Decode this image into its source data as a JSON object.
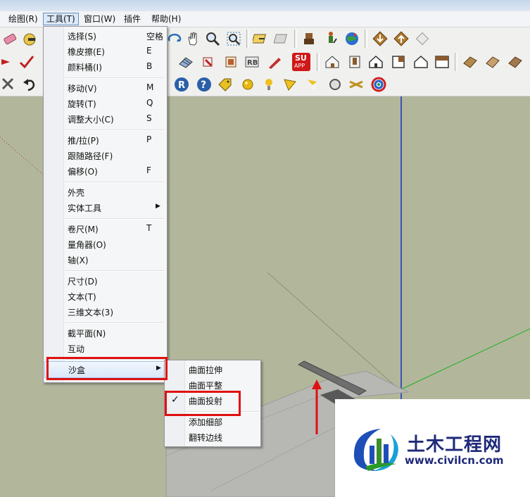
{
  "menubar": {
    "items": [
      {
        "label": "绘图(R)"
      },
      {
        "label": "工具(T)"
      },
      {
        "label": "窗口(W)"
      },
      {
        "label": "插件"
      },
      {
        "label": "帮助(H)"
      }
    ]
  },
  "tools_menu": {
    "items": [
      {
        "label": "选择(S)",
        "shortcut": "空格"
      },
      {
        "label": "橡皮擦(E)",
        "shortcut": "E"
      },
      {
        "label": "颜料桶(I)",
        "shortcut": "B"
      },
      {
        "label": "移动(V)",
        "shortcut": "M"
      },
      {
        "label": "旋转(T)",
        "shortcut": "Q"
      },
      {
        "label": "调整大小(C)",
        "shortcut": "S"
      },
      {
        "label": "推/拉(P)",
        "shortcut": "P"
      },
      {
        "label": "跟随路径(F)",
        "shortcut": ""
      },
      {
        "label": "偏移(O)",
        "shortcut": "F"
      },
      {
        "label": "外壳",
        "shortcut": ""
      },
      {
        "label": "实体工具",
        "shortcut": ""
      },
      {
        "label": "卷尺(M)",
        "shortcut": "T"
      },
      {
        "label": "量角器(O)",
        "shortcut": ""
      },
      {
        "label": "轴(X)",
        "shortcut": ""
      },
      {
        "label": "尺寸(D)",
        "shortcut": ""
      },
      {
        "label": "文本(T)",
        "shortcut": ""
      },
      {
        "label": "三维文本(3)",
        "shortcut": ""
      },
      {
        "label": "截平面(N)",
        "shortcut": ""
      },
      {
        "label": "互动",
        "shortcut": ""
      },
      {
        "label": "沙盒",
        "shortcut": ""
      }
    ]
  },
  "sandbox_submenu": {
    "items": [
      {
        "label": "曲面拉伸",
        "checked": false
      },
      {
        "label": "曲面平整",
        "checked": false
      },
      {
        "label": "曲面投射",
        "checked": true
      },
      {
        "label": "添加细部",
        "checked": false
      },
      {
        "label": "翻转边线",
        "checked": false
      }
    ],
    "check_glyph": "✓"
  },
  "toolbar": {
    "su_app_label": "SU",
    "su_app_sub": "APP"
  },
  "watermark": {
    "title": "土木工程网",
    "url": "www.civilcn.com"
  },
  "colors": {
    "highlight_red": "#e01010",
    "viewport_bg": "#b2b79c",
    "brand_blue": "#1f2a7a"
  }
}
